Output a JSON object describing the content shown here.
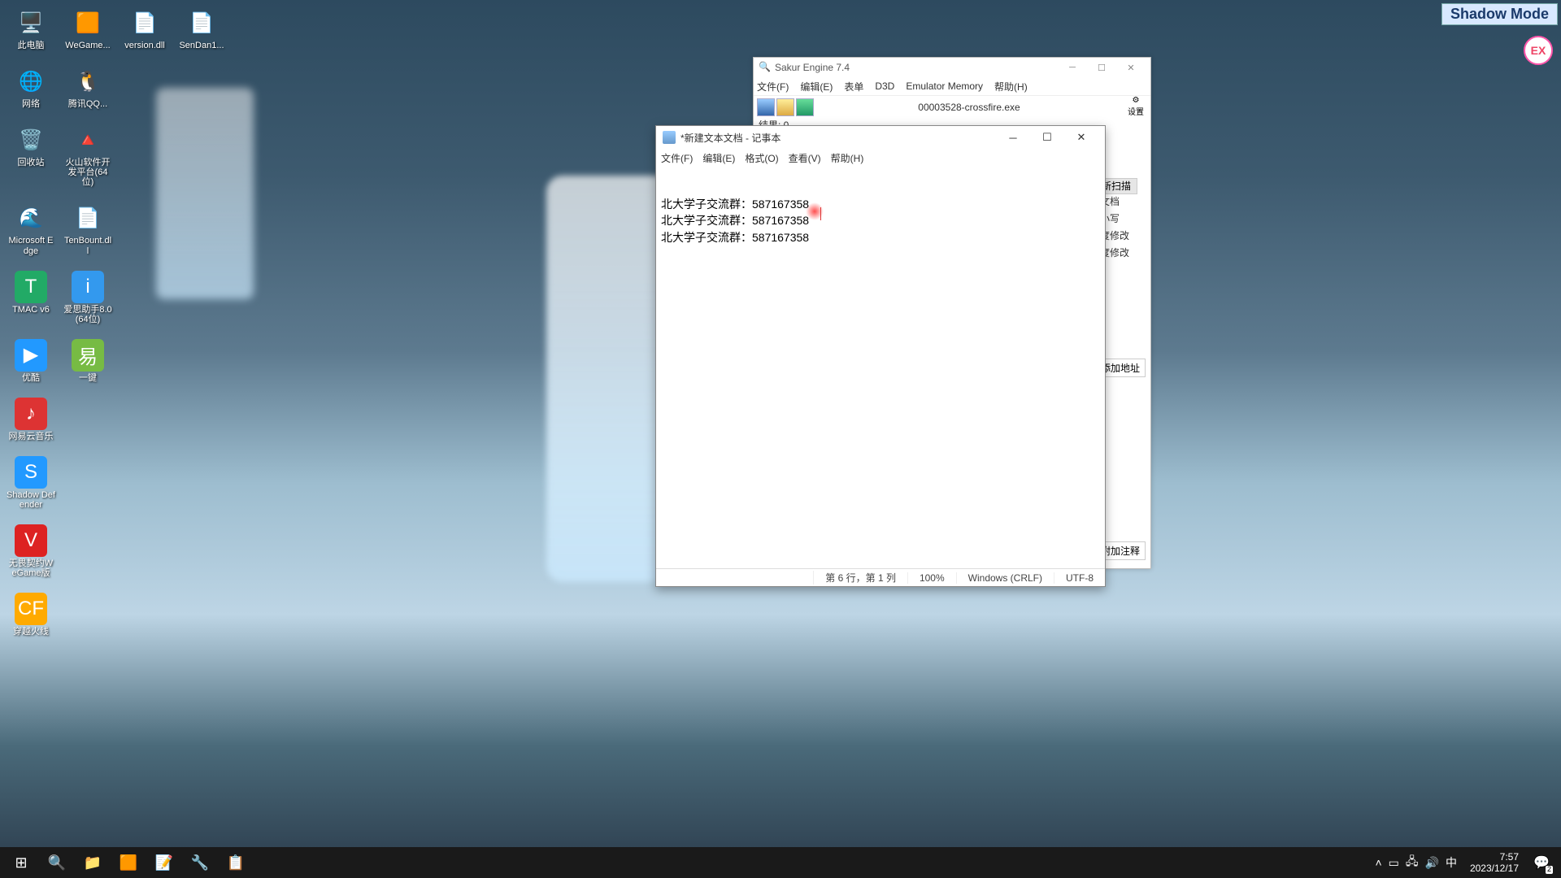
{
  "shadow_mode_label": "Shadow Mode",
  "desktop_icons": [
    {
      "label": "此电脑",
      "glyph": "🖥️",
      "bg": ""
    },
    {
      "label": "WeGame...",
      "glyph": "🟧",
      "bg": ""
    },
    {
      "label": "version.dll",
      "glyph": "📄",
      "bg": ""
    },
    {
      "label": "SenDan1...",
      "glyph": "📄",
      "bg": ""
    },
    {
      "label": "网络",
      "glyph": "🌐",
      "bg": ""
    },
    {
      "label": "腾讯QQ...",
      "glyph": "🐧",
      "bg": ""
    },
    {
      "label": "",
      "glyph": "",
      "bg": ""
    },
    {
      "label": "",
      "glyph": "",
      "bg": ""
    },
    {
      "label": "回收站",
      "glyph": "🗑️",
      "bg": ""
    },
    {
      "label": "火山软件开发平台(64位)",
      "glyph": "🔺",
      "bg": ""
    },
    {
      "label": "",
      "glyph": "",
      "bg": ""
    },
    {
      "label": "",
      "glyph": "",
      "bg": ""
    },
    {
      "label": "Microsoft Edge",
      "glyph": "🌊",
      "bg": ""
    },
    {
      "label": "TenBount.dll",
      "glyph": "📄",
      "bg": ""
    },
    {
      "label": "",
      "glyph": "",
      "bg": ""
    },
    {
      "label": "",
      "glyph": "",
      "bg": ""
    },
    {
      "label": "TMAC v6",
      "glyph": "T",
      "bg": "#2a6"
    },
    {
      "label": "爱思助手8.0(64位)",
      "glyph": "i",
      "bg": "#39e"
    },
    {
      "label": "",
      "glyph": "",
      "bg": ""
    },
    {
      "label": "",
      "glyph": "",
      "bg": ""
    },
    {
      "label": "优酷",
      "glyph": "▶",
      "bg": "#29f"
    },
    {
      "label": "一键",
      "glyph": "易",
      "bg": "#7b4"
    },
    {
      "label": "",
      "glyph": "",
      "bg": ""
    },
    {
      "label": "",
      "glyph": "",
      "bg": ""
    },
    {
      "label": "网易云音乐",
      "glyph": "♪",
      "bg": "#d33"
    },
    {
      "label": "",
      "glyph": "",
      "bg": ""
    },
    {
      "label": "",
      "glyph": "",
      "bg": ""
    },
    {
      "label": "",
      "glyph": "",
      "bg": ""
    },
    {
      "label": "Shadow Defender",
      "glyph": "S",
      "bg": "#29f"
    },
    {
      "label": "",
      "glyph": "",
      "bg": ""
    },
    {
      "label": "",
      "glyph": "",
      "bg": ""
    },
    {
      "label": "",
      "glyph": "",
      "bg": ""
    },
    {
      "label": "无畏契约WeGame版",
      "glyph": "V",
      "bg": "#d22"
    },
    {
      "label": "",
      "glyph": "",
      "bg": ""
    },
    {
      "label": "",
      "glyph": "",
      "bg": ""
    },
    {
      "label": "",
      "glyph": "",
      "bg": ""
    },
    {
      "label": "穿越火线",
      "glyph": "CF",
      "bg": "#fa0"
    }
  ],
  "sakur": {
    "title": "Sakur Engine 7.4",
    "menu": [
      "文件(F)",
      "编辑(E)",
      "表单",
      "D3D",
      "Emulator Memory",
      "帮助(H)"
    ],
    "process": "00003528-crossfire.exe",
    "settings_label": "设置",
    "result_label": "结果: 0",
    "scan_label": "新扫描",
    "side_labels": [
      "文档",
      "小写",
      "度修改",
      "度修改"
    ],
    "auto_add": "自动添加地址",
    "attach": "附加注释"
  },
  "notepad": {
    "title": "*新建文本文档 - 记事本",
    "menu": [
      "文件(F)",
      "编辑(E)",
      "格式(O)",
      "查看(V)",
      "帮助(H)"
    ],
    "lines": [
      "北大学子交流群：587167358",
      "北大学子交流群：587167358",
      "北大学子交流群：587167358"
    ],
    "status": {
      "position": "第 6 行，第 1 列",
      "zoom": "100%",
      "lineend": "Windows (CRLF)",
      "encoding": "UTF-8"
    }
  },
  "taskbar": {
    "items": [
      "⊞",
      "🔍",
      "📁",
      "🟧",
      "📝",
      "🔧",
      "📋"
    ]
  },
  "systray": {
    "ime": "中",
    "time": "7:57",
    "date": "2023/12/17",
    "notif_count": "2"
  }
}
